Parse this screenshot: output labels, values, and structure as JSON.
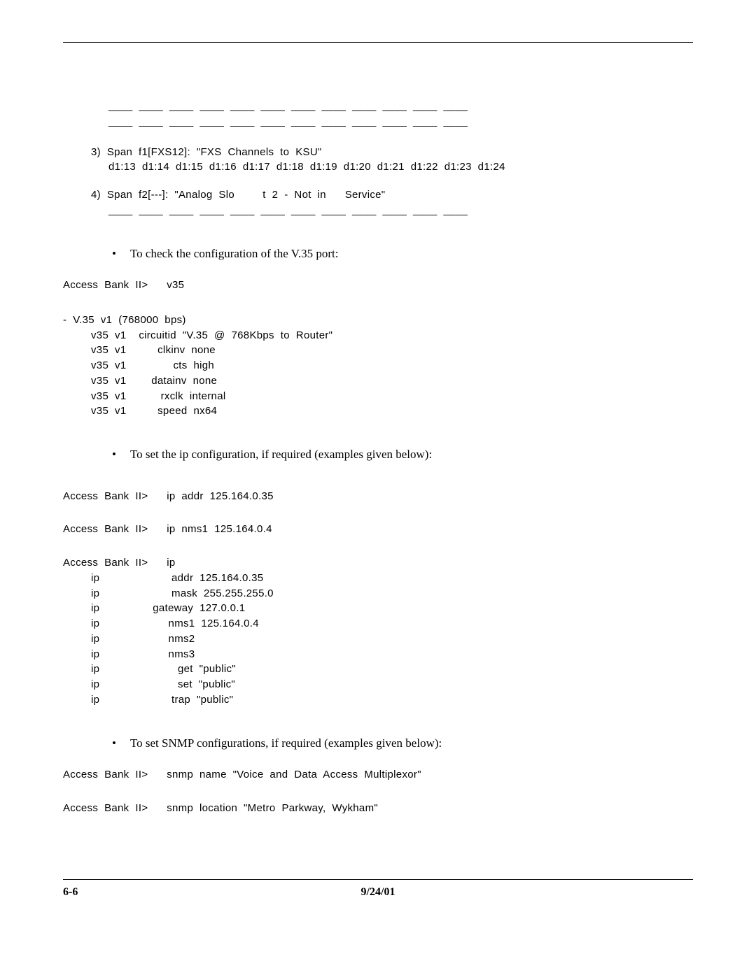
{
  "blanks": {
    "row": "____  ____  ____  ____  ____  ____  ____  ____  ____  ____  ____  ____"
  },
  "span3": {
    "line1": "3)  Span  f1[FXS12]:  \"FXS  Channels  to  KSU\"",
    "line2": "d1:13  d1:14  d1:15  d1:16  d1:17  d1:18  d1:19  d1:20  d1:21  d1:22  d1:23  d1:24"
  },
  "span4": {
    "line1": "4)  Span  f2[---]:  \"Analog  Slo         t  2  -  Not  in      Service\""
  },
  "bullet1": "To check the configuration of the V.35 port:",
  "v35": {
    "cmd": "Access  Bank  II>      v35",
    "header": "-  V.35  v1  (768000  bps)",
    "l1": "v35  v1    circuitid  \"V.35  @  768Kbps  to  Router\"",
    "l2": "v35  v1          clkinv  none",
    "l3": "v35  v1               cts  high",
    "l4": "v35  v1        datainv  none",
    "l5": "v35  v1           rxclk  internal",
    "l6": "v35  v1          speed  nx64"
  },
  "bullet2": "To set the ip configuration, if required (examples given below):",
  "ip": {
    "cmd1": "Access  Bank  II>      ip  addr  125.164.0.35",
    "cmd2": "Access  Bank  II>      ip  nms1  125.164.0.4",
    "cmd3": "Access  Bank  II>      ip",
    "l1": "ip                       addr  125.164.0.35",
    "l2": "ip                       mask  255.255.255.0",
    "l3": "ip                 gateway  127.0.0.1",
    "l4": "ip                      nms1  125.164.0.4",
    "l5": "ip                      nms2",
    "l6": "ip                      nms3",
    "l7": "ip                         get  \"public\"",
    "l8": "ip                         set  \"public\"",
    "l9": "ip                       trap  \"public\""
  },
  "bullet3": "To set SNMP configurations, if required (examples given below):",
  "snmp": {
    "cmd1": "Access  Bank  II>      snmp  name  \"Voice  and  Data  Access  Multiplexor\"",
    "cmd2": "Access  Bank  II>      snmp  location  \"Metro  Parkway,  Wykham\""
  },
  "footer": {
    "left": "6-6",
    "center": "9/24/01"
  }
}
